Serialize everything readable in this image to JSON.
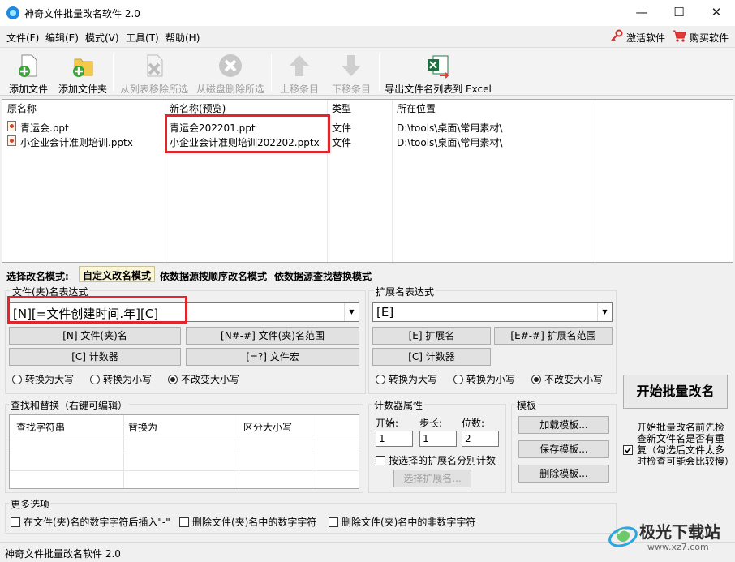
{
  "window": {
    "title": "神奇文件批量改名软件 2.0",
    "minimize": "—",
    "maximize": "☐",
    "close": "✕"
  },
  "menu": [
    "文件(F)",
    "编辑(E)",
    "模式(V)",
    "工具(T)",
    "帮助(H)"
  ],
  "top_right": {
    "activate": "激活软件",
    "buy": "购买软件"
  },
  "toolbar": {
    "add_file": "添加文件",
    "add_folder": "添加文件夹",
    "remove_list": "从列表移除所选",
    "delete_disk": "从磁盘删除所选",
    "move_up": "上移条目",
    "move_down": "下移条目",
    "export": "导出文件名列表到 Excel"
  },
  "file_list": {
    "columns": [
      "原名称",
      "新名称(预览)",
      "类型",
      "所在位置"
    ],
    "rows": [
      {
        "original": "青运会.ppt",
        "new_name": "青运会202201.ppt",
        "type": "文件",
        "location": "D:\\tools\\桌面\\常用素材\\"
      },
      {
        "original": "小企业会计准则培训.pptx",
        "new_name": "小企业会计准则培训202202.pptx",
        "type": "文件",
        "location": "D:\\tools\\桌面\\常用素材\\"
      }
    ]
  },
  "mode": {
    "label": "选择改名模式:",
    "tabs": [
      "自定义改名模式",
      "依数据源按顺序改名模式",
      "依数据源查找替换模式"
    ]
  },
  "name_expr": {
    "title": "文件(夹)名表达式",
    "value": "[N][=文件创建时间.年][C]",
    "buttons": [
      "[N] 文件(夹)名",
      "[N#-#] 文件(夹)名范围",
      "[C] 计数器",
      "[=?] 文件宏"
    ],
    "radios": [
      "转换为大写",
      "转换为小写",
      "不改变大小写"
    ]
  },
  "ext_expr": {
    "title": "扩展名表达式",
    "value": "[E]",
    "buttons": [
      "[E] 扩展名",
      "[E#-#] 扩展名范围",
      "[C] 计数器"
    ],
    "radios": [
      "转换为大写",
      "转换为小写",
      "不改变大小写"
    ]
  },
  "find_replace": {
    "title": "查找和替换（右键可编辑）",
    "columns": [
      "查找字符串",
      "替换为",
      "区分大小写"
    ]
  },
  "counter": {
    "title": "计数器属性",
    "start_label": "开始:",
    "step_label": "步长:",
    "digits_label": "位数:",
    "start": "1",
    "step": "1",
    "digits": "2",
    "per_ext": "按选择的扩展名分别计数",
    "choose_ext": "选择扩展名..."
  },
  "template": {
    "title": "模板",
    "load": "加载模板...",
    "save": "保存模板...",
    "delete": "删除模板..."
  },
  "start": {
    "button": "开始批量改名",
    "check_text": "开始批量改名前先检查新文件名是否有重复（勾选后文件太多时检查可能会比较慢）"
  },
  "more": {
    "title": "更多选项",
    "options": [
      "在文件(夹)名的数字字符后插入\"-\"",
      "删除文件(夹)名中的数字字符",
      "删除文件(夹)名中的非数字字符"
    ]
  },
  "status": {
    "text": "神奇文件批量改名软件 2.0"
  },
  "watermark": {
    "text": "极光下载站",
    "url": "www.xz7.com"
  }
}
